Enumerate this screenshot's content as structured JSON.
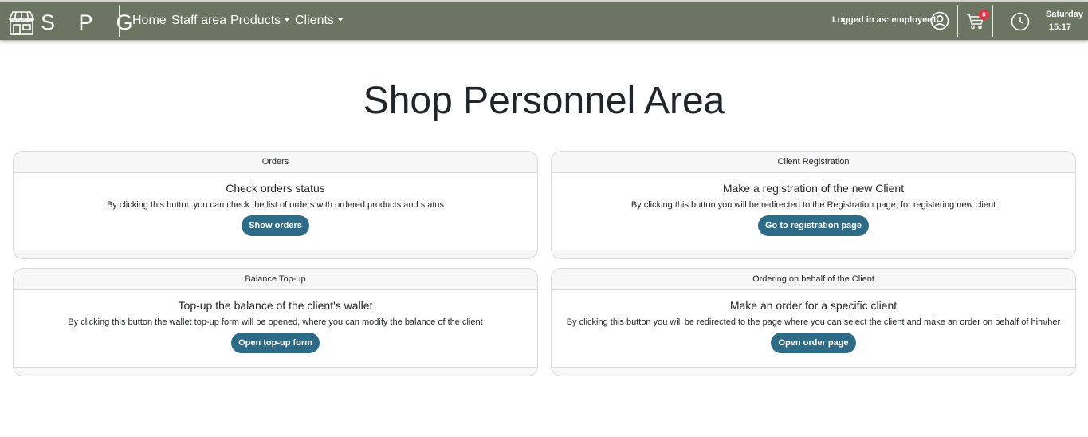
{
  "navbar": {
    "brand": "S P G",
    "links": {
      "home": "Home",
      "staff_area": "Staff area",
      "products": "Products",
      "clients": "Clients"
    },
    "logged_in_label": "Logged in as: employee1",
    "cart_count": "0",
    "day": "Saturday",
    "time": "15:17",
    "background_color": "#6b7561"
  },
  "main": {
    "title": "Shop Personnel Area"
  },
  "cards": {
    "orders": {
      "header": "Orders",
      "title": "Check orders status",
      "text": "By clicking this button you can check the list of orders with ordered products and status",
      "button": "Show orders"
    },
    "registration": {
      "header": "Client Registration",
      "title": "Make a registration of the new Client",
      "text": "By clicking this button you will be redirected to the Registration page, for registering new client",
      "button": "Go to registration page"
    },
    "topup": {
      "header": "Balance Top-up",
      "title": "Top-up the balance of the client's wallet",
      "text": "By clicking this button the wallet top-up form will be opened, where you can modify the balance of the client",
      "button": "Open top-up form"
    },
    "ordering": {
      "header": "Ordering on behalf of the Client",
      "title": "Make an order for a specific client",
      "text": "By clicking this button you will be redirected to the page where you can select the client and make an order on behalf of him/her",
      "button": "Open order page"
    }
  },
  "colors": {
    "button": "#2e6b87",
    "badge": "#dc3545"
  },
  "icons": [
    "shop-logo-icon",
    "user-circle-icon",
    "cart-icon",
    "clock-icon",
    "caret-down-icon"
  ]
}
